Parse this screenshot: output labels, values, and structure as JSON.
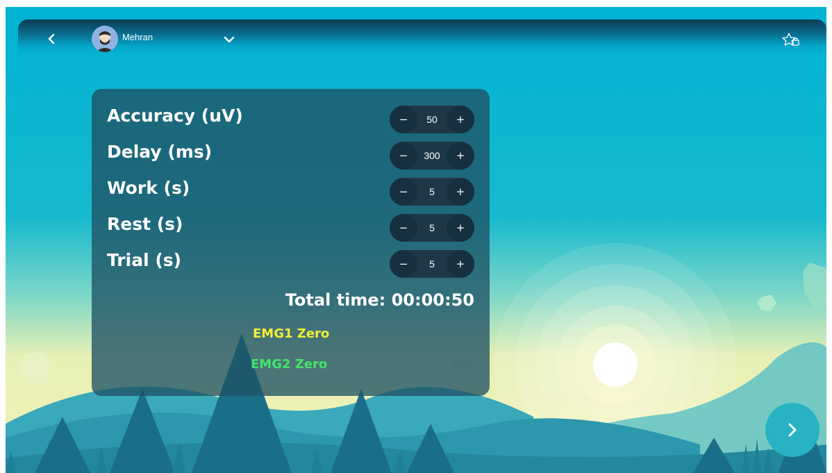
{
  "user": {
    "name": "Mehran"
  },
  "icons": {
    "back": "chevron-left-icon",
    "dropdown": "chevron-down-icon",
    "favorites": "star-lock-icon",
    "next": "chevron-right-icon",
    "minus": "−",
    "plus": "+"
  },
  "settings": [
    {
      "label": "Accuracy (uV)",
      "value": "50"
    },
    {
      "label": "Delay (ms)",
      "value": "300"
    },
    {
      "label": "Work (s)",
      "value": "5"
    },
    {
      "label": "Rest (s)",
      "value": "5"
    },
    {
      "label": "Trial (s)",
      "value": "5"
    }
  ],
  "total_time": "Total time: 00:00:50",
  "emg": [
    {
      "label": "EMG1 Zero",
      "color": "#f3ef36"
    },
    {
      "label": "EMG2 Zero",
      "color": "#43e46b"
    }
  ],
  "colors": {
    "sky_top": "#00b3d3",
    "panel": "#1f5264",
    "stepper": "#1f3848",
    "next_button": "#27b3c4"
  }
}
